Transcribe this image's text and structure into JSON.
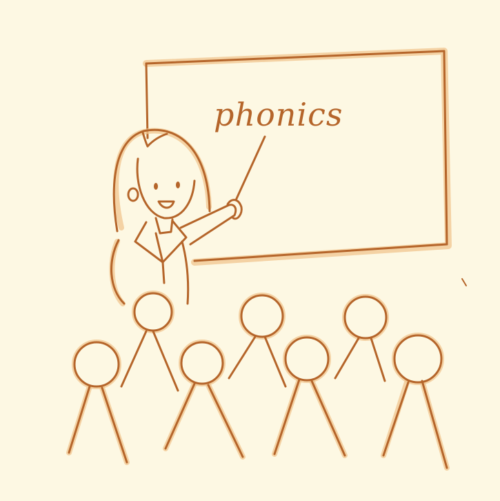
{
  "blackboard": {
    "word": "phonics"
  },
  "colors": {
    "background": "#fdf8e3",
    "line": "#b5652a",
    "shadow": "#f0c58f"
  }
}
